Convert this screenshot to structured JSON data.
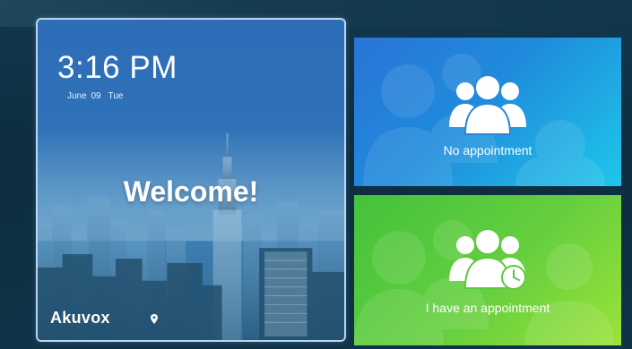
{
  "welcome_panel": {
    "time": "3:16 PM",
    "date": "June 09",
    "weekday": "Tue",
    "greeting": "Welcome!",
    "brand": "Akuvox"
  },
  "cards": {
    "no_appointment": {
      "label": "No appointment",
      "icon": "people-group-icon",
      "color": "#1f8bdc"
    },
    "appointment": {
      "label": "I have an appointment",
      "icon": "people-group-clock-icon",
      "color": "#66cf3e"
    }
  }
}
